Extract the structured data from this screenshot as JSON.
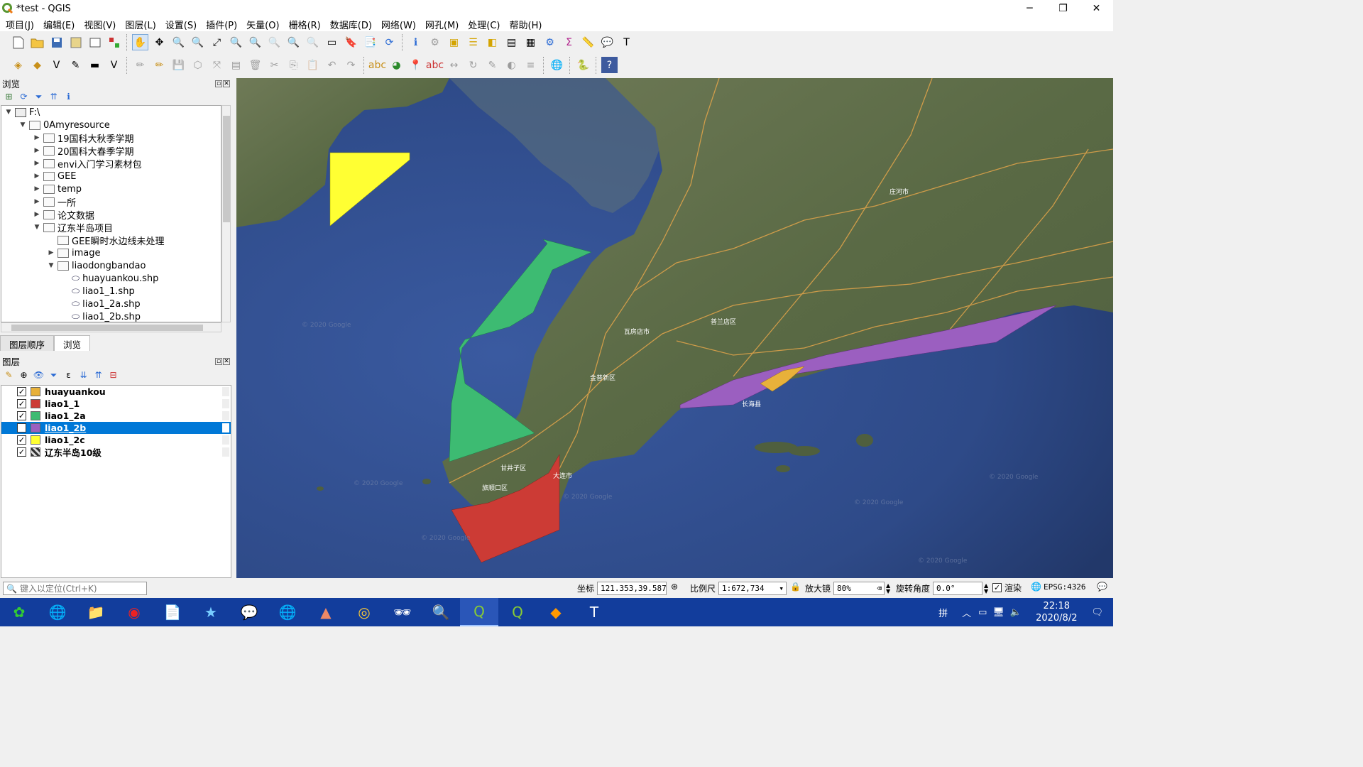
{
  "window": {
    "title": "*test - QGIS",
    "min": "─",
    "max": "❐",
    "close": "✕"
  },
  "menu": [
    "项目(J)",
    "编辑(E)",
    "视图(V)",
    "图层(L)",
    "设置(S)",
    "插件(P)",
    "矢量(O)",
    "栅格(R)",
    "数据库(D)",
    "网络(W)",
    "网孔(M)",
    "处理(C)",
    "帮助(H)"
  ],
  "browser": {
    "title": "浏览",
    "items": [
      {
        "label": "F:\\",
        "level": 0,
        "arrow": "▼",
        "icon": "drive"
      },
      {
        "label": "0Amyresource",
        "level": 1,
        "arrow": "▼",
        "icon": "folder"
      },
      {
        "label": "19国科大秋季学期",
        "level": 2,
        "arrow": "▶",
        "icon": "folder"
      },
      {
        "label": "20国科大春季学期",
        "level": 2,
        "arrow": "▶",
        "icon": "folder"
      },
      {
        "label": "envi入门学习素材包",
        "level": 2,
        "arrow": "▶",
        "icon": "folder"
      },
      {
        "label": "GEE",
        "level": 2,
        "arrow": "▶",
        "icon": "folder"
      },
      {
        "label": "temp",
        "level": 2,
        "arrow": "▶",
        "icon": "folder"
      },
      {
        "label": "一所",
        "level": 2,
        "arrow": "▶",
        "icon": "folder"
      },
      {
        "label": "论文数据",
        "level": 2,
        "arrow": "▶",
        "icon": "folder"
      },
      {
        "label": "辽东半岛项目",
        "level": 2,
        "arrow": "▼",
        "icon": "folder"
      },
      {
        "label": "GEE瞬时水边线未处理",
        "level": 3,
        "arrow": "",
        "icon": "folder"
      },
      {
        "label": "image",
        "level": 3,
        "arrow": "▶",
        "icon": "folder"
      },
      {
        "label": "liaodongbandao",
        "level": 3,
        "arrow": "▼",
        "icon": "folder"
      },
      {
        "label": "huayuankou.shp",
        "level": 4,
        "arrow": "",
        "icon": "shp"
      },
      {
        "label": "liao1_1.shp",
        "level": 4,
        "arrow": "",
        "icon": "shp"
      },
      {
        "label": "liao1_2a.shp",
        "level": 4,
        "arrow": "",
        "icon": "shp"
      },
      {
        "label": "liao1_2b.shp",
        "level": 4,
        "arrow": "",
        "icon": "shp"
      }
    ]
  },
  "tabs": {
    "order": "图层顺序",
    "browse": "浏览"
  },
  "layers_panel": {
    "title": "图层",
    "layers": [
      {
        "name": "huayuankou",
        "color": "#e8b13a",
        "checked": "✓",
        "selected": false
      },
      {
        "name": "liao1_1",
        "color": "#cc3b35",
        "checked": "✓",
        "selected": false
      },
      {
        "name": "liao1_2a",
        "color": "#3dbb72",
        "checked": "✓",
        "selected": false
      },
      {
        "name": "liao1_2b",
        "color": "#9b5fc0",
        "checked": "✓",
        "selected": true
      },
      {
        "name": "liao1_2c",
        "color": "#ffff33",
        "checked": "✓",
        "selected": false
      },
      {
        "name": "辽东半岛10级",
        "color": "raster",
        "checked": "✓",
        "selected": false
      }
    ]
  },
  "map": {
    "labels": [
      "旅顺口区",
      "甘井子区",
      "大连市",
      "长海县",
      "金普新区",
      "瓦房店市",
      "普兰店区",
      "庄河市"
    ],
    "watermark": "© 2020 Google",
    "colors": {
      "sea": "#2f4a86",
      "land": "#5c6a46",
      "yellow": "#ffff33",
      "green": "#3dbb72",
      "red": "#cc3b35",
      "purple": "#9b5fc0",
      "orange": "#e8b13a"
    }
  },
  "status": {
    "search_placeholder": "键入以定位(Ctrl+K)",
    "coord_label": "坐标",
    "coord_value": "121.353,39.587",
    "scale_label": "比例尺",
    "scale_value": "1:672,734",
    "magnifier_label": "放大镜",
    "magnifier_value": "80%",
    "rotation_label": "旋转角度",
    "rotation_value": "0.0°",
    "render_label": "渲染",
    "epsg": "EPSG:4326"
  },
  "taskbar": {
    "ime": "拼",
    "time": "22:18",
    "date": "2020/8/2"
  }
}
